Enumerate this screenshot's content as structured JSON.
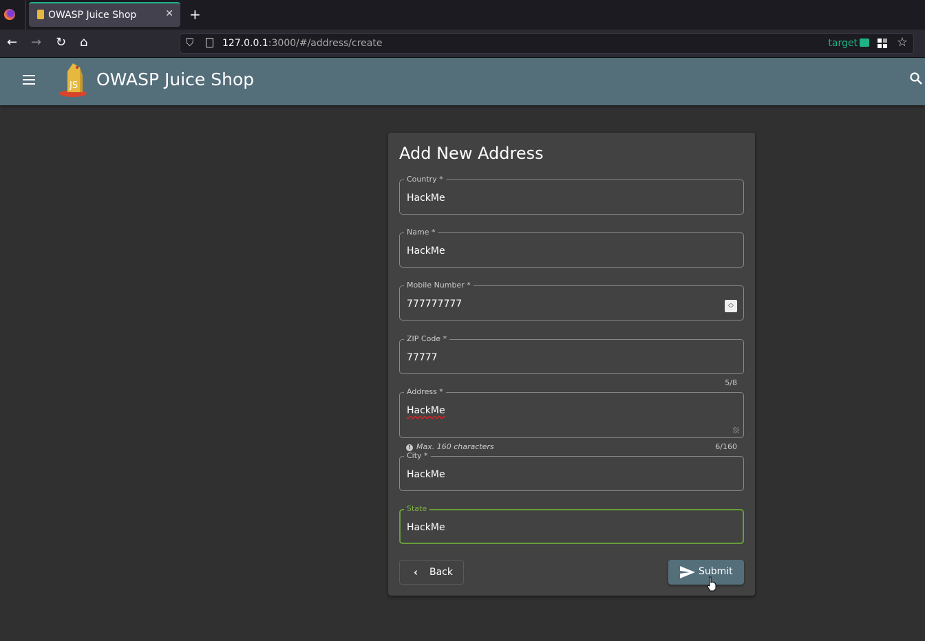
{
  "browser": {
    "tab_title": "OWASP Juice Shop",
    "url_host": "127.0.0.1",
    "url_rest": ":3000/#/address/create",
    "container_label": "target"
  },
  "app": {
    "title": "OWASP Juice Shop"
  },
  "form": {
    "title": "Add New Address",
    "fields": [
      {
        "label": "Country *",
        "value": "HackMe"
      },
      {
        "label": "Name *",
        "value": "HackMe"
      },
      {
        "label": "Mobile Number *",
        "value": "777777777"
      },
      {
        "label": "ZIP Code *",
        "value": "77777",
        "counter": "5/8"
      },
      {
        "label": "Address *",
        "value": "HackMe",
        "hint": "Max. 160 characters",
        "counter": "6/160"
      },
      {
        "label": "City *",
        "value": "HackMe"
      },
      {
        "label": "State",
        "value": "HackMe"
      }
    ],
    "back_label": "Back",
    "submit_label": "Submit"
  },
  "colors": {
    "appbar": "#546e7a",
    "focus": "#689f38",
    "accent": "#1fb386"
  }
}
